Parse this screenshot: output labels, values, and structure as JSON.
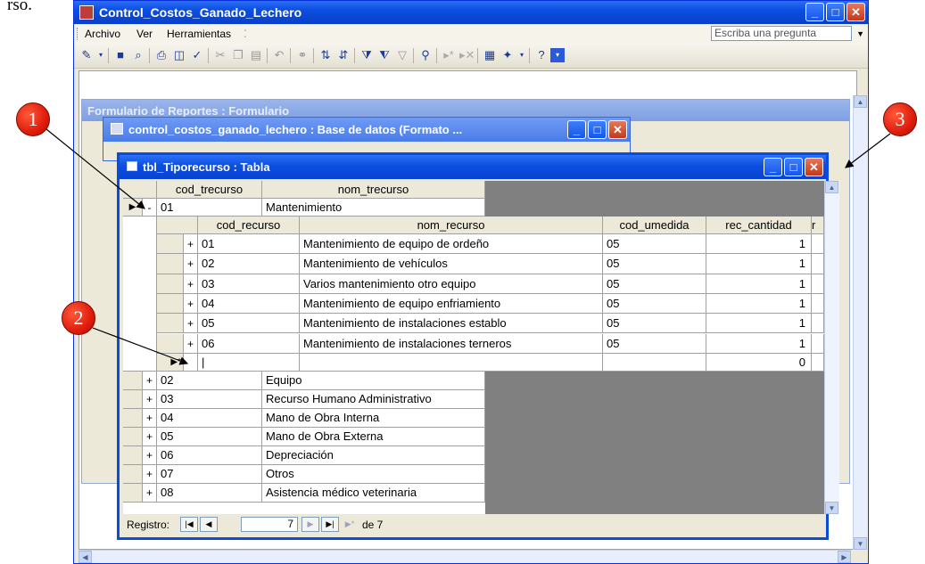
{
  "page_text": "rso.",
  "app": {
    "title": "Control_Costos_Ganado_Lechero",
    "menu": [
      "Archivo",
      "Ver",
      "Herramientas"
    ],
    "ask_placeholder": "Escriba una pregunta"
  },
  "form_window": {
    "title": "Formulario de Reportes : Formulario"
  },
  "db_window": {
    "title": "control_costos_ganado_lechero : Base de datos (Formato ..."
  },
  "table_window": {
    "title": "tbl_Tiporecurso : Tabla",
    "outer_columns": [
      "cod_trecurso",
      "nom_trecurso"
    ],
    "expanded_row": {
      "code": "01",
      "name": "Mantenimiento",
      "expander": "-"
    },
    "sub_columns": [
      "cod_recurso",
      "nom_recurso",
      "cod_umedida",
      "rec_cantidad",
      "r"
    ],
    "sub_rows": [
      {
        "expander": "+",
        "cod": "01",
        "nom": "Mantenimiento de equipo de ordeño",
        "um": "05",
        "cant": "1"
      },
      {
        "expander": "+",
        "cod": "02",
        "nom": "Mantenimiento de vehículos",
        "um": "05",
        "cant": "1"
      },
      {
        "expander": "+",
        "cod": "03",
        "nom": "Varios mantenimiento otro equipo",
        "um": "05",
        "cant": "1"
      },
      {
        "expander": "+",
        "cod": "04",
        "nom": "Mantenimiento de equipo enfriamiento",
        "um": "05",
        "cant": "1"
      },
      {
        "expander": "+",
        "cod": "05",
        "nom": "Mantenimiento de instalaciones establo",
        "um": "05",
        "cant": "1"
      },
      {
        "expander": "+",
        "cod": "06",
        "nom": "Mantenimiento de instalaciones terneros",
        "um": "05",
        "cant": "1"
      }
    ],
    "sub_new_row_cant": "0",
    "outer_rows": [
      {
        "expander": "+",
        "code": "02",
        "name": "Equipo"
      },
      {
        "expander": "+",
        "code": "03",
        "name": "Recurso Humano Administrativo"
      },
      {
        "expander": "+",
        "code": "04",
        "name": "Mano de Obra Interna"
      },
      {
        "expander": "+",
        "code": "05",
        "name": "Mano de Obra Externa"
      },
      {
        "expander": "+",
        "code": "06",
        "name": "Depreciación"
      },
      {
        "expander": "+",
        "code": "07",
        "name": "Otros"
      },
      {
        "expander": "+",
        "code": "08",
        "name": "Asistencia médico veterinaria"
      }
    ],
    "navigator": {
      "label": "Registro:",
      "current": "7",
      "total": "de 7"
    }
  },
  "callouts": [
    "1",
    "2",
    "3"
  ],
  "colors": {
    "title_blue": "#0b4ee0",
    "callout_red": "#e01c0c",
    "close_red": "#c4381a"
  }
}
